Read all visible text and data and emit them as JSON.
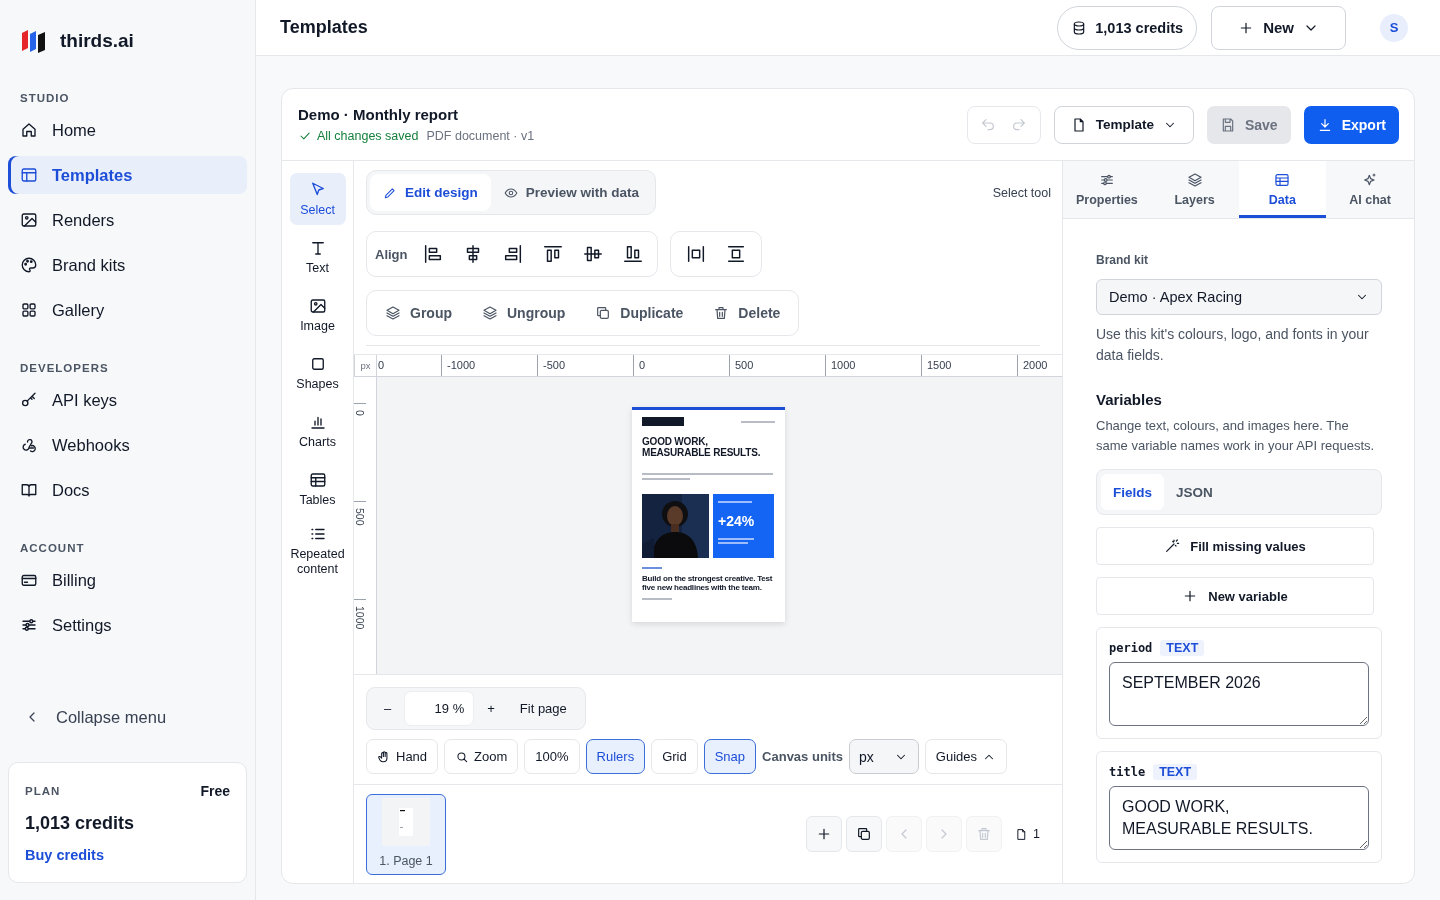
{
  "brand": {
    "name": "thirds.ai"
  },
  "sidebar": {
    "sections": [
      {
        "title": "STUDIO",
        "items": [
          {
            "label": "Home",
            "selected": false
          },
          {
            "label": "Templates",
            "selected": true
          },
          {
            "label": "Renders",
            "selected": false
          },
          {
            "label": "Brand kits",
            "selected": false
          },
          {
            "label": "Gallery",
            "selected": false
          }
        ]
      },
      {
        "title": "DEVELOPERS",
        "items": [
          {
            "label": "API keys",
            "selected": false
          },
          {
            "label": "Webhooks",
            "selected": false
          },
          {
            "label": "Docs",
            "selected": false
          }
        ]
      },
      {
        "title": "ACCOUNT",
        "items": [
          {
            "label": "Billing",
            "selected": false
          },
          {
            "label": "Settings",
            "selected": false
          }
        ]
      }
    ],
    "collapse": "Collapse menu",
    "plan": {
      "label": "PLAN",
      "tier": "Free",
      "credits": "1,013 credits",
      "link": "Buy credits"
    }
  },
  "topbar": {
    "title": "Templates",
    "credits": "1,013 credits",
    "new_button": "New",
    "avatar": "S"
  },
  "editor": {
    "title": "Demo · Monthly report",
    "saved": "All changes saved",
    "meta": "PDF document · v1",
    "history": [
      {
        "disabled": true
      },
      {
        "disabled": true
      }
    ],
    "template_button": "Template",
    "save": {
      "label": "Save",
      "disabled": true
    },
    "export": "Export"
  },
  "tools": [
    {
      "label": "Select",
      "selected": true
    },
    {
      "label": "Text",
      "selected": false
    },
    {
      "label": "Image",
      "selected": false
    },
    {
      "label": "Shapes",
      "selected": false
    },
    {
      "label": "Charts",
      "selected": false
    },
    {
      "label": "Tables",
      "selected": false
    },
    {
      "label": "Repeated content",
      "selected": false
    }
  ],
  "modes": [
    {
      "label": "Edit design",
      "selected": true
    },
    {
      "label": "Preview with data",
      "selected": false
    }
  ],
  "tool_hint": "Select tool",
  "align_label": "Align",
  "actions": [
    "Group",
    "Ungroup",
    "Duplicate",
    "Delete"
  ],
  "ruler": {
    "unit": "px",
    "ticks": [
      "0",
      "-1000",
      "-500",
      "0",
      "500",
      "1000",
      "1500",
      "2000"
    ],
    "vticks": [
      "0",
      "500",
      "1000"
    ]
  },
  "page_preview": {
    "headline": "GOOD WORK,\nMEASURABLE RESULTS.",
    "stat": "+24%",
    "body": "Build on the strongest creative. Test five new headlines with the team."
  },
  "zoom": {
    "minus": "–",
    "value": "19 %",
    "plus": "+",
    "fit": "Fit page"
  },
  "view_toggles": [
    {
      "label": "Hand",
      "on": false
    },
    {
      "label": "Zoom",
      "on": false
    },
    {
      "label": "100%",
      "on": false
    },
    {
      "label": "Rulers",
      "on": true
    },
    {
      "label": "Grid",
      "on": false
    },
    {
      "label": "Snap",
      "on": true
    }
  ],
  "canvas_units": {
    "label": "Canvas units",
    "value": "px"
  },
  "guides": "Guides",
  "pages": [
    {
      "label": "1. Page 1",
      "selected": true
    }
  ],
  "page_actions": [
    {
      "disabled": false
    },
    {
      "disabled": false
    },
    {
      "disabled": true
    },
    {
      "disabled": true
    },
    {
      "disabled": true
    }
  ],
  "page_count": "1",
  "panel": {
    "tabs": [
      {
        "label": "Properties",
        "selected": false
      },
      {
        "label": "Layers",
        "selected": false
      },
      {
        "label": "Data",
        "selected": true
      },
      {
        "label": "AI chat",
        "selected": false
      }
    ],
    "brand_kit": {
      "label": "Brand kit",
      "value": "Demo · Apex Racing",
      "help": "Use this kit's colours, logo, and fonts in your data fields."
    },
    "variables": {
      "title": "Variables",
      "help": "Change text, colours, and images here. The same variable names work in your API requests.",
      "view_tabs": [
        {
          "label": "Fields",
          "selected": true
        },
        {
          "label": "JSON",
          "selected": false
        }
      ],
      "fill_button": "Fill missing values",
      "new_button": "New variable",
      "items": [
        {
          "name": "period",
          "type": "TEXT",
          "value": "SEPTEMBER 2026"
        },
        {
          "name": "title",
          "type": "TEXT",
          "value": "GOOD WORK,\nMEASURABLE RESULTS."
        }
      ]
    }
  }
}
